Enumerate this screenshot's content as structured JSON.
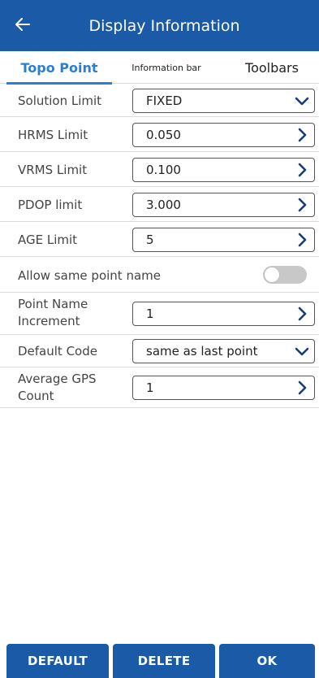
{
  "header": {
    "title": "Display Information",
    "back_icon": "arrow-left-icon",
    "background": "#1a5aa6"
  },
  "tabs": [
    {
      "label": "Topo Point",
      "active": true
    },
    {
      "label": "Information bar",
      "active": false
    },
    {
      "label": "Toolbars",
      "active": false
    }
  ],
  "settings": {
    "solution_limit": {
      "label": "Solution Limit",
      "value": "FIXED",
      "control": "dropdown",
      "icon": "chevron-down-icon"
    },
    "hrms_limit": {
      "label": "HRMS Limit",
      "value": "0.050",
      "control": "input",
      "icon": "chevron-right-icon"
    },
    "vrms_limit": {
      "label": "VRMS Limit",
      "value": "0.100",
      "control": "input",
      "icon": "chevron-right-icon"
    },
    "pdop_limit": {
      "label": "PDOP limit",
      "value": "3.000",
      "control": "input",
      "icon": "chevron-right-icon"
    },
    "age_limit": {
      "label": "AGE Limit",
      "value": "5",
      "control": "input",
      "icon": "chevron-right-icon"
    },
    "allow_same_name": {
      "label": "Allow same point name",
      "enabled": false,
      "control": "toggle"
    },
    "point_name_increment": {
      "label_line1": "Point Name",
      "label_line2": "Increment",
      "value": "1",
      "control": "input",
      "icon": "chevron-right-icon"
    },
    "default_code": {
      "label": "Default Code",
      "value": "same as last point",
      "control": "dropdown",
      "icon": "chevron-down-icon"
    },
    "average_gps_count": {
      "label_line1": "Average GPS",
      "label_line2": "Count",
      "value": "1",
      "control": "input",
      "icon": "chevron-right-icon"
    }
  },
  "footer": {
    "default_label": "DEFAULT",
    "delete_label": "DELETE",
    "ok_label": "OK"
  },
  "colors": {
    "primary": "#1a5aa6",
    "tab_active": "#2a7fd4",
    "icon": "#1a3d7a",
    "toggle_off": "#c8c8c8"
  }
}
